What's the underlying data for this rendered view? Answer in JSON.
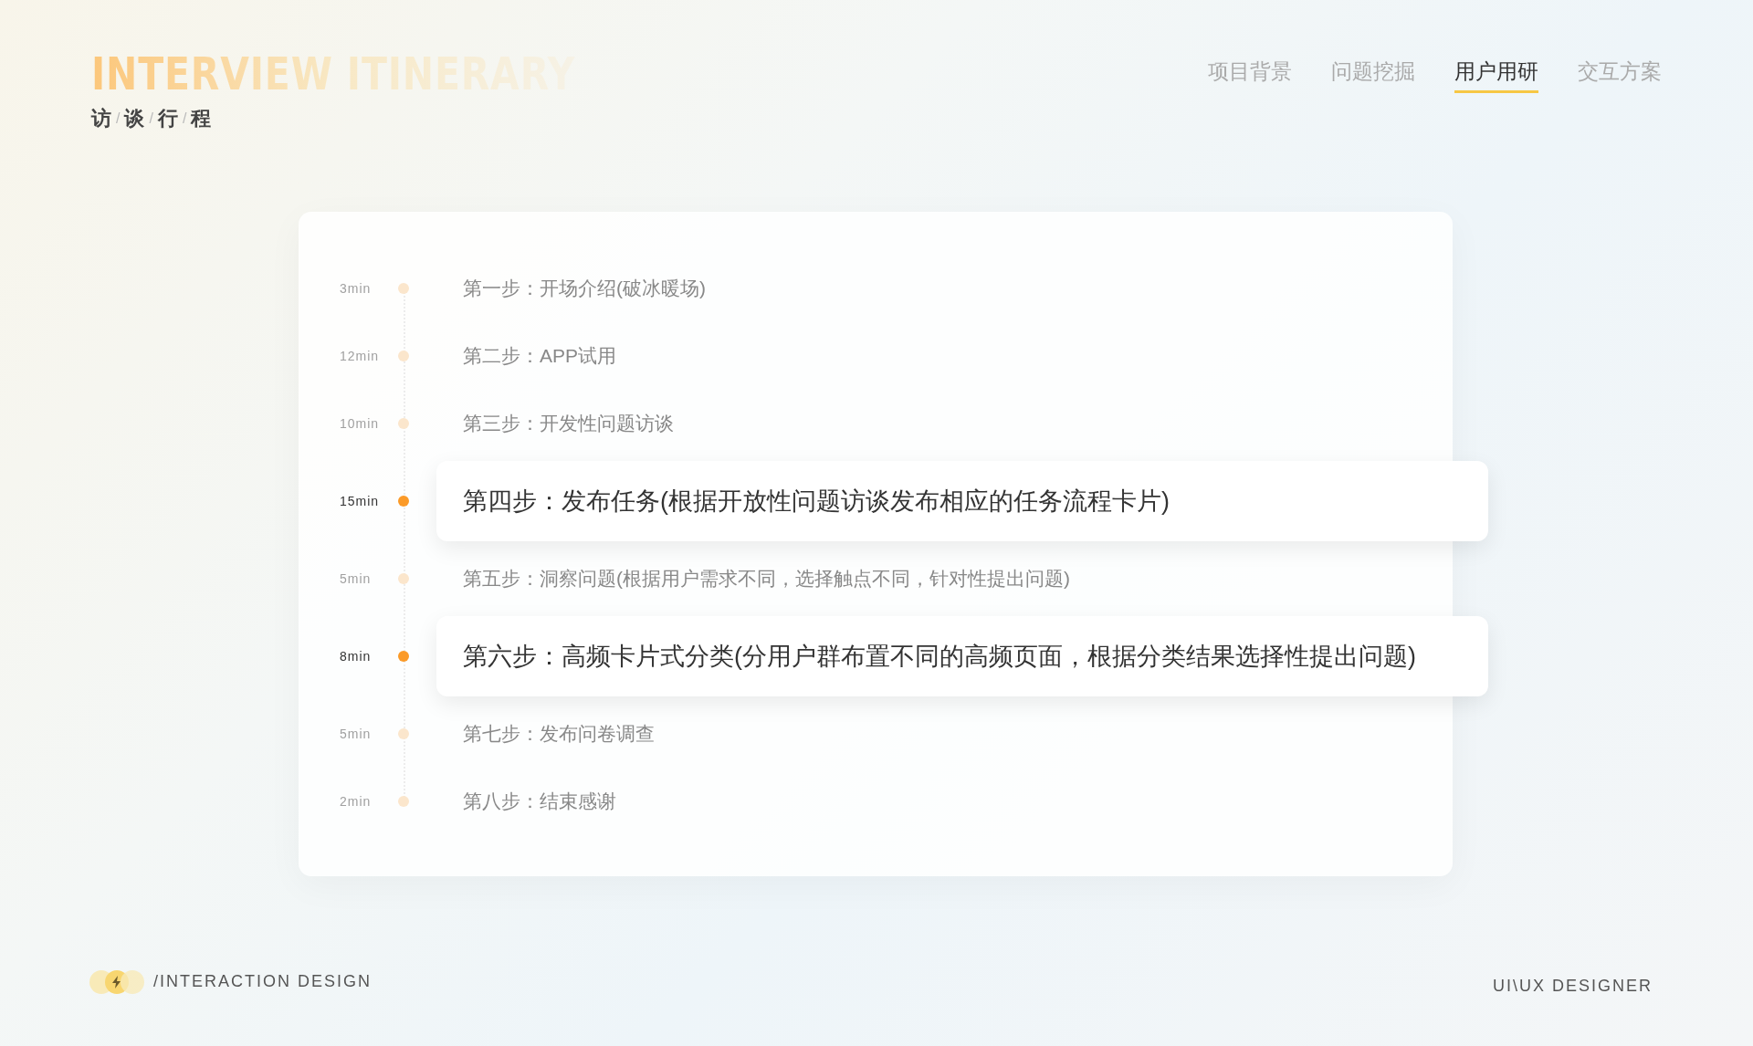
{
  "header": {
    "title": "INTERVIEW ITINERARY",
    "subtitle": {
      "characters": [
        "访",
        "谈",
        "行",
        "程"
      ],
      "separators": [
        "/",
        "/",
        "/"
      ]
    }
  },
  "tabs": [
    {
      "label": "项目背景",
      "selected": false
    },
    {
      "label": "问题挖掘",
      "selected": false
    },
    {
      "label": "用户用研",
      "selected": true
    },
    {
      "label": "交互方案",
      "selected": false
    }
  ],
  "timeline": [
    {
      "duration": "3min",
      "step": "第一步：开场介绍(破冰暖场)",
      "highlighted": false
    },
    {
      "duration": "12min",
      "step": "第二步：APP试用",
      "highlighted": false
    },
    {
      "duration": "10min",
      "step": "第三步：开发性问题访谈",
      "highlighted": false
    },
    {
      "duration": "15min",
      "step": "第四步：发布任务(根据开放性问题访谈发布相应的任务流程卡片)",
      "highlighted": true
    },
    {
      "duration": "5min",
      "step": "第五步：洞察问题(根据用户需求不同，选择触点不同，针对性提出问题)",
      "highlighted": false
    },
    {
      "duration": "8min",
      "step": "第六步：高频卡片式分类(分用户群布置不同的高频页面，根据分类结果选择性提出问题)",
      "highlighted": true
    },
    {
      "duration": "5min",
      "step": "第七步：发布问卷调查",
      "highlighted": false
    },
    {
      "duration": "2min",
      "step": "第八步：结束感谢",
      "highlighted": false
    }
  ],
  "footer": {
    "brand": "/INTERACTION DESIGN",
    "role": "UI\\UX DESIGNER"
  }
}
